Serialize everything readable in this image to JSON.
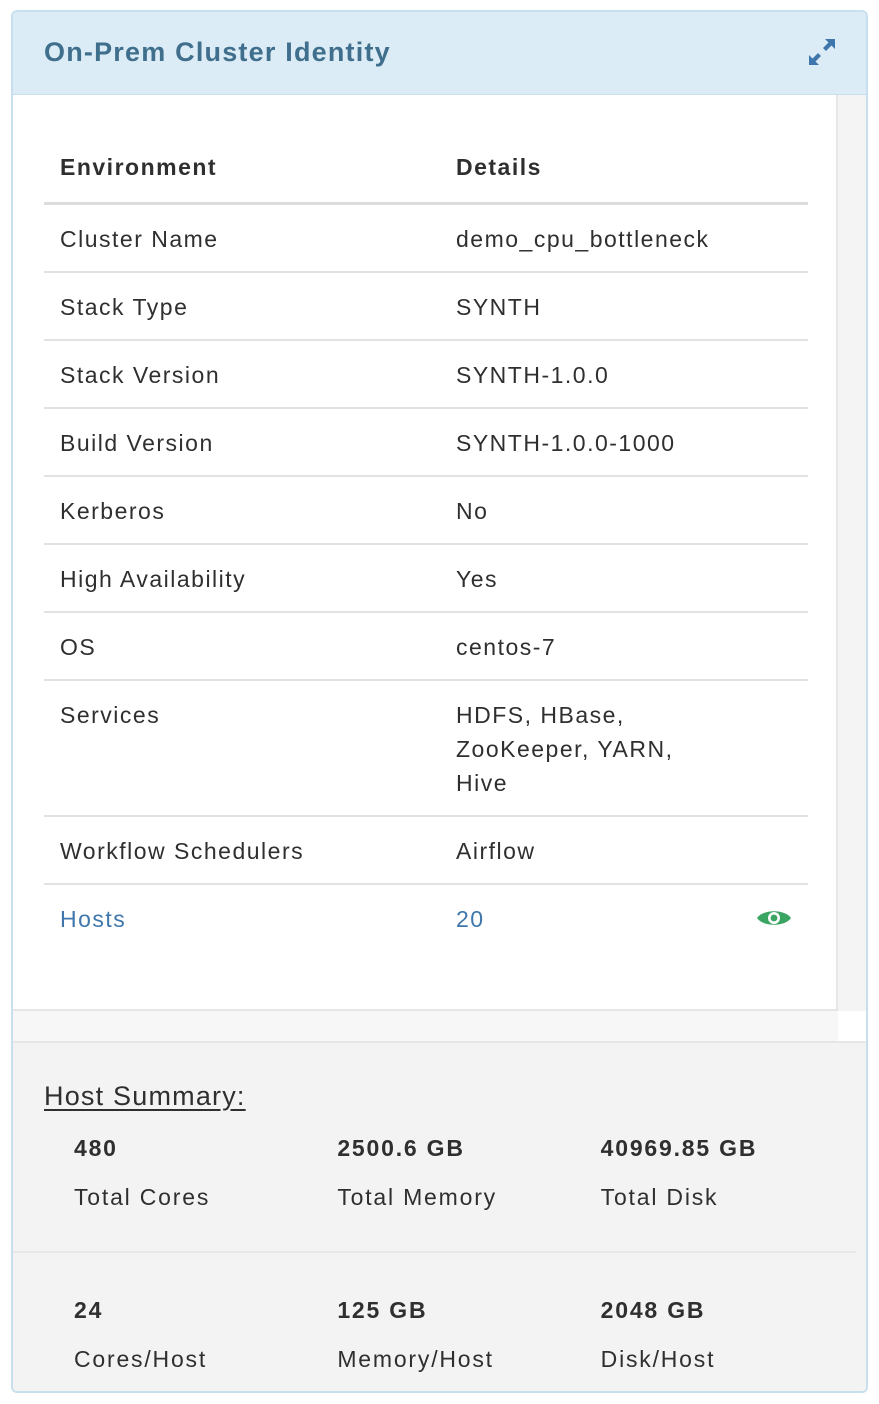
{
  "card": {
    "title": "On-Prem Cluster Identity",
    "expand_icon": "expand-arrows-icon"
  },
  "table": {
    "headers": [
      "Environment",
      "Details"
    ],
    "rows": [
      {
        "label": "Cluster Name",
        "value": "demo_cpu_bottleneck"
      },
      {
        "label": "Stack Type",
        "value": "SYNTH"
      },
      {
        "label": "Stack Version",
        "value": "SYNTH-1.0.0"
      },
      {
        "label": "Build Version",
        "value": "SYNTH-1.0.0-1000"
      },
      {
        "label": "Kerberos",
        "value": "No"
      },
      {
        "label": "High Availability",
        "value": "Yes"
      },
      {
        "label": "OS",
        "value": "centos-7"
      },
      {
        "label": "Services",
        "value_lines": [
          "HDFS, HBase,",
          "ZooKeeper, YARN,",
          "Hive"
        ]
      },
      {
        "label": "Workflow Schedulers",
        "value": "Airflow"
      },
      {
        "label": "Hosts",
        "value": "20",
        "icon": "eye-icon"
      }
    ]
  },
  "host_summary": {
    "title": "Host Summary:",
    "totals": [
      {
        "value": "480",
        "label": "Total Cores"
      },
      {
        "value": "2500.6 GB",
        "label": "Total Memory"
      },
      {
        "value": "40969.85 GB",
        "label": "Total Disk"
      }
    ],
    "per_host": [
      {
        "value": "24",
        "label": "Cores/Host"
      },
      {
        "value": "125 GB",
        "label": "Memory/Host"
      },
      {
        "value": "2048 GB",
        "label": "Disk/Host"
      }
    ]
  },
  "colors": {
    "header_bg": "#dcecf6",
    "title": "#3f6f8c",
    "link": "#3f77ad",
    "eye_icon": "#3aa463"
  }
}
